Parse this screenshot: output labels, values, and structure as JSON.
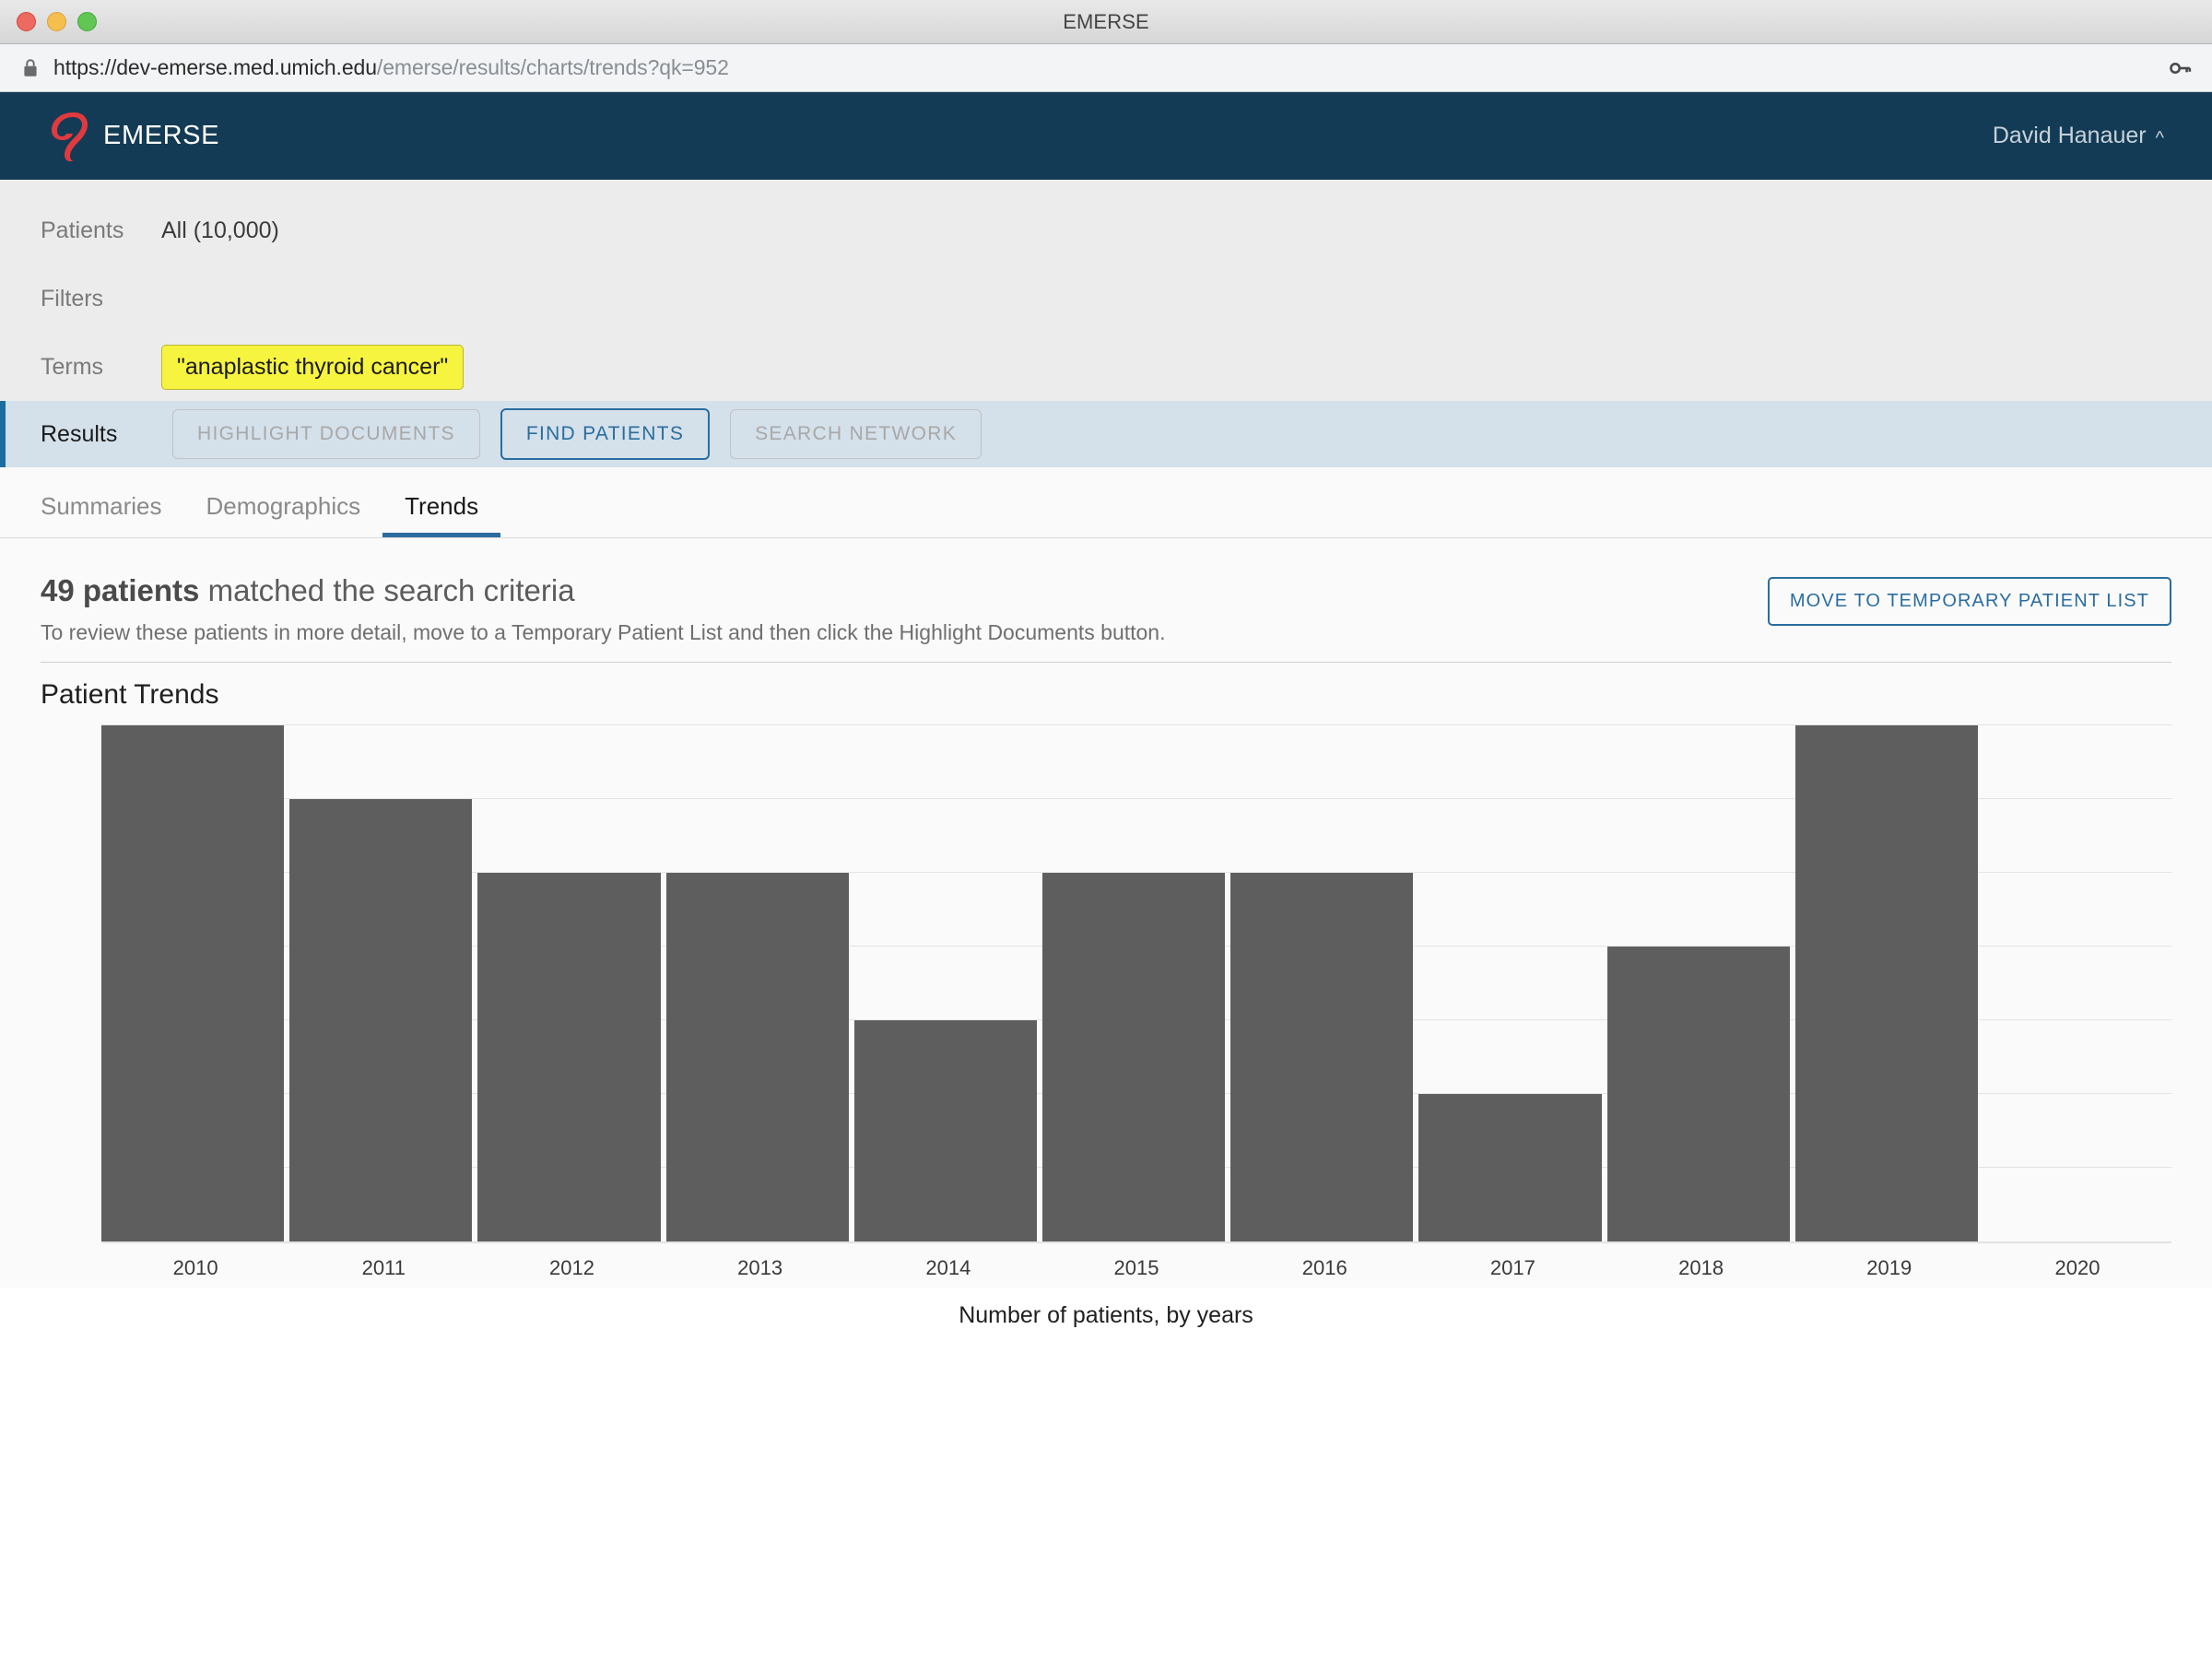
{
  "window": {
    "title": "EMERSE",
    "traffic_lights": [
      "close",
      "minimize",
      "maximize"
    ]
  },
  "browser": {
    "url_scheme_host": "https://dev-emerse.med.umich.edu",
    "url_path": "/emerse/results/charts/trends?qk=952",
    "lock_icon": "lock-icon",
    "key_icon": "key-icon"
  },
  "app_header": {
    "brand": "EMERSE",
    "logo_icon": "emerse-logo-icon",
    "user_name": "David Hanauer",
    "user_caret": "^",
    "navy": "#133b55"
  },
  "query_panel": {
    "rows": [
      {
        "label": "Patients",
        "value": "All (10,000)"
      },
      {
        "label": "Filters",
        "value": ""
      },
      {
        "label": "Terms",
        "value": ""
      },
      {
        "label": "Results",
        "value": ""
      }
    ],
    "term_chip": "\"anaplastic thyroid cancer\"",
    "term_chip_color": "#f7f43f",
    "buttons": {
      "highlight_documents": "HIGHLIGHT DOCUMENTS",
      "find_patients": "FIND PATIENTS",
      "search_network": "SEARCH NETWORK"
    }
  },
  "tabs": [
    {
      "label": "Summaries",
      "active": false
    },
    {
      "label": "Demographics",
      "active": false
    },
    {
      "label": "Trends",
      "active": true
    }
  ],
  "results": {
    "count_text": "49 patients",
    "heading_rest": " matched the search criteria",
    "subtext": "To review these patients in more detail, move to a Temporary Patient List and then click the Highlight Documents button.",
    "move_button": "MOVE TO TEMPORARY PATIENT LIST",
    "chart_title": "Patient Trends",
    "accent_color": "#2a6d9e"
  },
  "chart_data": {
    "type": "bar",
    "title": "Patient Trends",
    "categories": [
      "2010",
      "2011",
      "2012",
      "2013",
      "2014",
      "2015",
      "2016",
      "2017",
      "2018",
      "2019",
      "2020"
    ],
    "values": [
      7,
      6,
      5,
      5,
      3,
      5,
      5,
      2,
      4,
      7,
      0
    ],
    "xlabel": "Number of patients, by years",
    "ylabel": "",
    "ylim": [
      0,
      7
    ],
    "gridlines": [
      1,
      2,
      3,
      4,
      5,
      6,
      7
    ],
    "grid": true,
    "legend": false,
    "bar_color": "#5e5e5e",
    "total": 49
  }
}
